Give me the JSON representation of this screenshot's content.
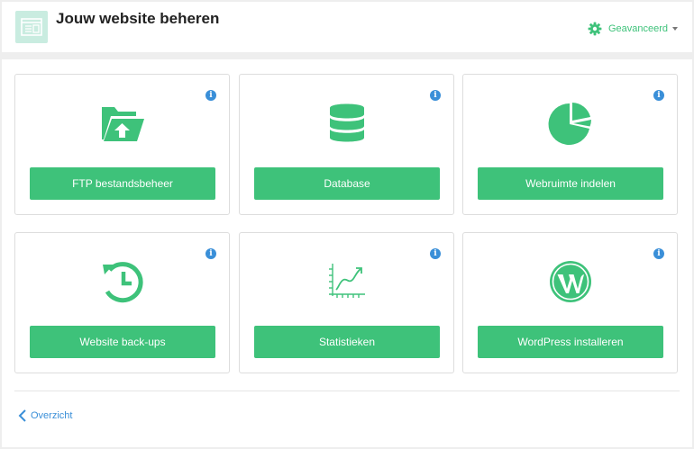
{
  "header": {
    "title": "Jouw website beheren",
    "icon": "website-window-icon",
    "advanced_label": "Geavanceerd",
    "advanced_icon": "gear-icon"
  },
  "cards": [
    {
      "label": "FTP bestandsbeheer",
      "icon": "folder-upload-icon",
      "info_icon": "info-icon"
    },
    {
      "label": "Database",
      "icon": "database-icon",
      "info_icon": "info-icon"
    },
    {
      "label": "Webruimte indelen",
      "icon": "pie-chart-icon",
      "info_icon": "info-icon"
    },
    {
      "label": "Website back-ups",
      "icon": "backup-clock-icon",
      "info_icon": "info-icon"
    },
    {
      "label": "Statistieken",
      "icon": "statistics-chart-icon",
      "info_icon": "info-icon"
    },
    {
      "label": "WordPress installeren",
      "icon": "wordpress-icon",
      "info_icon": "info-icon"
    }
  ],
  "footer": {
    "back_label": "Overzicht",
    "back_icon": "chevron-left-icon"
  },
  "colors": {
    "accent": "#3ec27a",
    "link": "#3a8fd8",
    "header_icon_bg": "#c9ece0"
  }
}
